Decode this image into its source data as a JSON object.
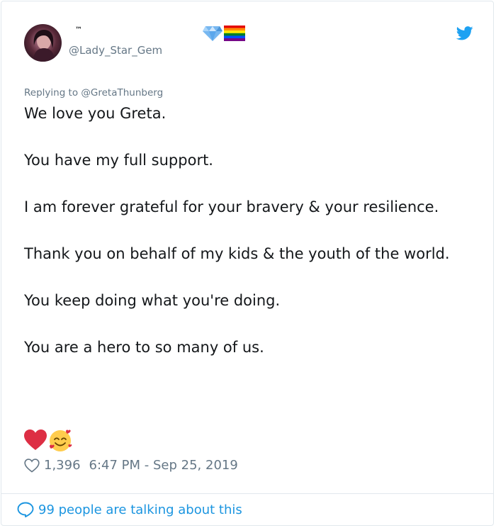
{
  "tweet": {
    "display_name_glyph": "™",
    "handle": "@Lady_Star_Gem",
    "badges": [
      "gem-emoji",
      "rainbow-flag-emoji"
    ],
    "source_icon": "twitter-bird-icon",
    "replying_to": "Replying to @GretaThunberg",
    "paragraphs": [
      "We love you Greta.",
      "You have my full support.",
      "I am forever grateful for your bravery & your resilience.",
      "Thank you on behalf of my kids & the youth of the world.",
      "You keep doing what you're doing.",
      "You are a hero to so many of us."
    ],
    "emoji_line": [
      "red-heart-emoji",
      "smiling-face-with-hearts-emoji"
    ],
    "like_count": "1,396",
    "timestamp": "6:47 PM - Sep 25, 2019",
    "talking_label": "99 people are talking about this"
  },
  "colors": {
    "text": "#14171a",
    "muted": "#657786",
    "link": "#1b95e0",
    "border": "#e1e8ed",
    "heart": "#dd2e44"
  }
}
